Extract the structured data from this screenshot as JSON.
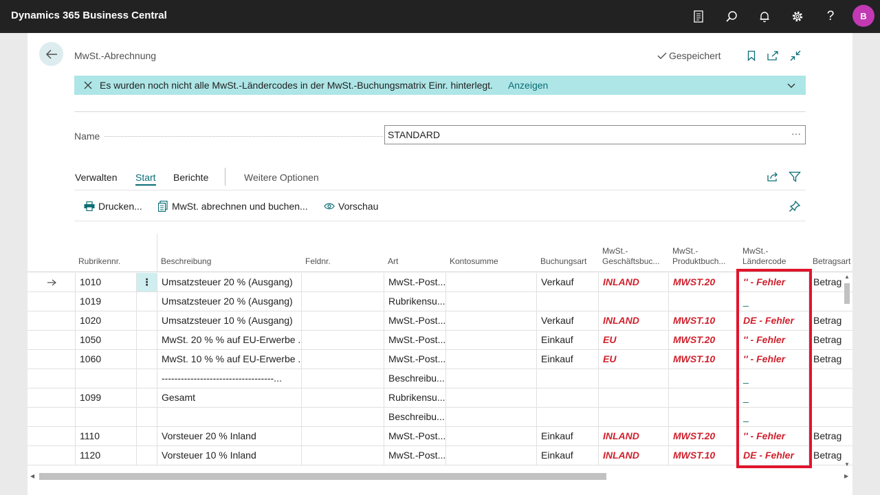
{
  "app": {
    "title": "Dynamics 365 Business Central",
    "avatar": "B"
  },
  "page": {
    "title": "MwSt.-Abrechnung",
    "saved_status": "Gespeichert"
  },
  "banner": {
    "message": "Es wurden noch nicht alle MwSt.-Ländercodes in der MwSt.-Buchungsmatrix Einr. hinterlegt.",
    "link": "Anzeigen"
  },
  "name_field": {
    "label": "Name",
    "value": "STANDARD",
    "more": "···"
  },
  "tabs": {
    "verwalten": "Verwalten",
    "start": "Start",
    "berichte": "Berichte",
    "weitere": "Weitere Optionen"
  },
  "actions": {
    "drucken": "Drucken...",
    "abrechnen": "MwSt. abrechnen und buchen...",
    "vorschau": "Vorschau"
  },
  "columns": {
    "rubrik": "Rubrikennr.",
    "beschreibung": "Beschreibung",
    "feldnr": "Feldnr.",
    "art": "Art",
    "kontosumme": "Kontosumme",
    "buchungsart": "Buchungsart",
    "geschaeft_1": "MwSt.-",
    "geschaeft_2": "Geschäftsbuc...",
    "produkt_1": "MwSt.-",
    "produkt_2": "Produktbuch...",
    "laender_1": "MwSt.-",
    "laender_2": "Ländercode",
    "betragsart": "Betragsart"
  },
  "rows": [
    {
      "nr": "1010",
      "beschreibung": "Umsatzsteuer 20 % (Ausgang)",
      "art": "MwSt.-Post...",
      "buchungsart": "Verkauf",
      "geschaeft": "INLAND",
      "produkt": "MWST.20",
      "land": "'' - Fehler",
      "betrag": "Betrag"
    },
    {
      "nr": "1019",
      "beschreibung": "Umsatzsteuer 20 % (Ausgang)",
      "art": "Rubrikensu...",
      "buchungsart": "",
      "geschaeft": "",
      "produkt": "",
      "land": "_",
      "betrag": ""
    },
    {
      "nr": "1020",
      "beschreibung": "Umsatzsteuer 10 % (Ausgang)",
      "art": "MwSt.-Post...",
      "buchungsart": "Verkauf",
      "geschaeft": "INLAND",
      "produkt": "MWST.10",
      "land": "DE - Fehler",
      "betrag": "Betrag"
    },
    {
      "nr": "1050",
      "beschreibung": "MwSt. 20 % % auf EU-Erwerbe ...",
      "art": "MwSt.-Post...",
      "buchungsart": "Einkauf",
      "geschaeft": "EU",
      "produkt": "MWST.20",
      "land": "'' - Fehler",
      "betrag": "Betrag"
    },
    {
      "nr": "1060",
      "beschreibung": "MwSt. 10 % % auf EU-Erwerbe ...",
      "art": "MwSt.-Post...",
      "buchungsart": "Einkauf",
      "geschaeft": "EU",
      "produkt": "MWST.10",
      "land": "'' - Fehler",
      "betrag": "Betrag"
    },
    {
      "nr": "",
      "beschreibung": "-----------------------------------...",
      "art": "Beschreibu...",
      "buchungsart": "",
      "geschaeft": "",
      "produkt": "",
      "land": "_",
      "betrag": ""
    },
    {
      "nr": "1099",
      "beschreibung": "Gesamt",
      "art": "Rubrikensu...",
      "buchungsart": "",
      "geschaeft": "",
      "produkt": "",
      "land": "_",
      "betrag": ""
    },
    {
      "nr": "",
      "beschreibung": "",
      "art": "Beschreibu...",
      "buchungsart": "",
      "geschaeft": "",
      "produkt": "",
      "land": "_",
      "betrag": ""
    },
    {
      "nr": "1110",
      "beschreibung": "Vorsteuer 20 % Inland",
      "art": "MwSt.-Post...",
      "buchungsart": "Einkauf",
      "geschaeft": "INLAND",
      "produkt": "MWST.20",
      "land": "'' - Fehler",
      "betrag": "Betrag"
    },
    {
      "nr": "1120",
      "beschreibung": "Vorsteuer 10 % Inland",
      "art": "MwSt.-Post...",
      "buchungsart": "Einkauf",
      "geschaeft": "INLAND",
      "produkt": "MWST.10",
      "land": "DE - Fehler",
      "betrag": "Betrag"
    }
  ],
  "colors": {
    "accent": "#0a6c74",
    "error": "#d0212d",
    "highlight": "#e2142c",
    "banner": "#aee6e7"
  }
}
